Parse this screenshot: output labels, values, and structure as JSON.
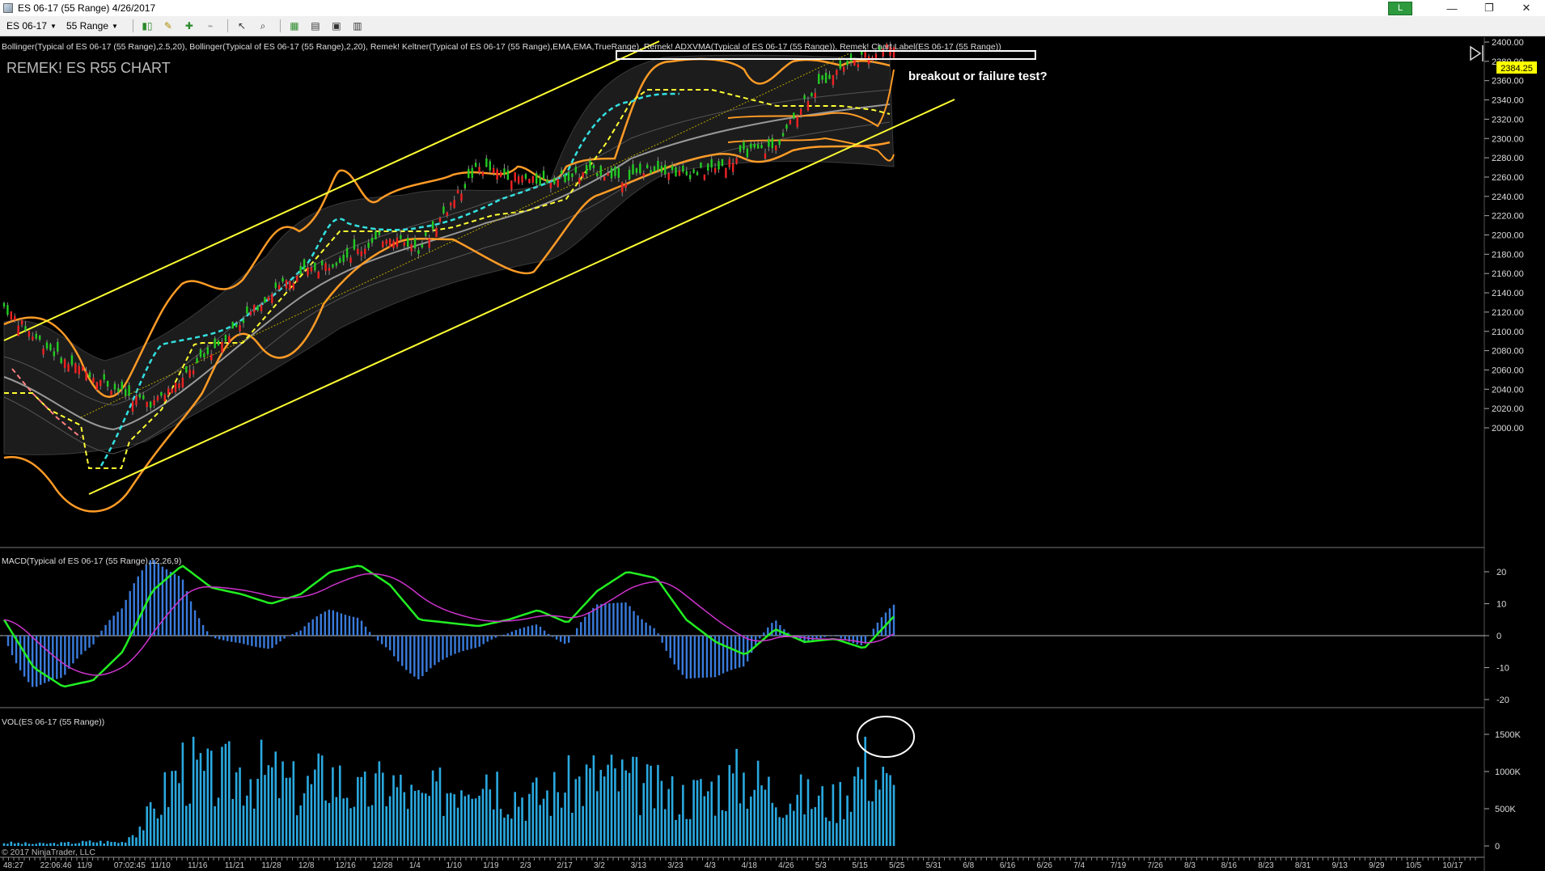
{
  "window": {
    "title": "ES 06-17 (55 Range)  4/26/2017",
    "badge": "L",
    "minimize": "—",
    "restore": "❐",
    "close": "✕"
  },
  "toolbar": {
    "instrument": "ES 06-17",
    "interval": "55 Range"
  },
  "indicators_label": "Bollinger(Typical of ES 06-17 (55 Range),2.5,20), Bollinger(Typical of ES 06-17 (55 Range),2,20), Remek! Keltner(Typical of ES 06-17 (55 Range),EMA,EMA,TrueRange), Remek! ADXVMA(Typical of ES 06-17 (55 Range)), Remek! Chart Label(ES 06-17 (55 Range))",
  "chart_label": "REMEK! ES R55 CHART",
  "annotation": "breakout or failure test?",
  "price_marker": "2384.25",
  "price_axis": [
    "2400.00",
    "2380.00",
    "2360.00",
    "2340.00",
    "2320.00",
    "2300.00",
    "2280.00",
    "2260.00",
    "2240.00",
    "2220.00",
    "2200.00",
    "2180.00",
    "2160.00",
    "2140.00",
    "2120.00",
    "2100.00",
    "2080.00",
    "2060.00",
    "2040.00",
    "2020.00",
    "2000.00"
  ],
  "macd_label": "MACD(Typical of ES 06-17 (55 Range),12,26,9)",
  "macd_axis": [
    "20",
    "10",
    "0",
    "-10",
    "-20"
  ],
  "vol_label": "VOL(ES 06-17 (55 Range))",
  "vol_axis": [
    "1500K",
    "1000K",
    "500K",
    "0"
  ],
  "copyright": "© 2017 NinjaTrader, LLC",
  "time_axis": [
    "48:27",
    "22:06:46",
    "11/9",
    "07:02:45",
    "11/10",
    "11/16",
    "11/21",
    "11/28",
    "12/8",
    "12/16",
    "12/28",
    "1/4",
    "1/10",
    "1/19",
    "2/3",
    "2/17",
    "3/2",
    "3/13",
    "3/23",
    "4/3",
    "4/18",
    "4/26",
    "5/3",
    "5/15",
    "5/25",
    "5/31",
    "6/8",
    "6/16",
    "6/26",
    "7/4",
    "7/19",
    "7/26",
    "8/3",
    "8/16",
    "8/23",
    "8/31",
    "9/13",
    "9/29",
    "10/5",
    "10/17"
  ],
  "colors": {
    "background": "#000000",
    "channel": "#ffff33",
    "bollinger_outer": "#ff9b26",
    "keltner": "#888888",
    "adxvma": "#ffff33",
    "adxvma_dn": "#ff8080",
    "trail_cyan": "#33e0e0",
    "macd": "#22ee22",
    "signal": "#cc33cc",
    "histogram": "#3a7bdc",
    "volume": "#2aa9e0",
    "price_marker_bg": "#ffff00"
  },
  "chart_data": [
    {
      "type": "line",
      "name": "price",
      "ylim": [
        1990,
        2410
      ],
      "x": [
        0,
        10,
        20,
        30,
        40,
        50,
        60,
        70,
        80,
        90,
        100,
        110,
        120,
        130,
        140,
        150,
        160,
        170,
        180,
        190,
        200,
        210,
        220,
        230,
        240,
        250,
        260,
        270,
        280,
        290,
        300
      ],
      "series": [
        {
          "values": [
            2125,
            2095,
            2070,
            2055,
            2035,
            2025,
            2050,
            2080,
            2110,
            2140,
            2160,
            2170,
            2185,
            2200,
            2185,
            2230,
            2270,
            2262,
            2255,
            2260,
            2265,
            2258,
            2270,
            2262,
            2268,
            2285,
            2290,
            2340,
            2370,
            2385,
            2398
          ]
        }
      ]
    },
    {
      "type": "line",
      "name": "macd",
      "ylim": [
        -22,
        24
      ],
      "x": [
        0,
        10,
        20,
        30,
        40,
        50,
        60,
        70,
        80,
        90,
        100,
        110,
        120,
        130,
        140,
        150,
        160,
        170,
        180,
        190,
        200,
        210,
        220,
        230,
        240,
        250,
        260,
        270,
        280,
        290,
        300
      ],
      "series": [
        {
          "values": [
            5,
            -10,
            -16,
            -14,
            -5,
            14,
            22,
            15,
            13,
            10,
            13,
            20,
            22,
            16,
            5,
            4,
            3,
            5,
            8,
            4,
            14,
            20,
            18,
            5,
            -2,
            -6,
            2,
            -2,
            -1,
            -4,
            6
          ]
        }
      ]
    },
    {
      "type": "bar",
      "name": "volume",
      "ylim": [
        0,
        1800
      ],
      "x": [
        0,
        10,
        20,
        30,
        40,
        50,
        60,
        70,
        80,
        90,
        100,
        110,
        120,
        130,
        140,
        150,
        160,
        170,
        180,
        190,
        200,
        210,
        220,
        230,
        240,
        250,
        260,
        270,
        280,
        290,
        300
      ],
      "values": [
        60,
        40,
        50,
        80,
        70,
        600,
        1500,
        1200,
        1400,
        1300,
        1000,
        1350,
        900,
        1200,
        800,
        1100,
        1600,
        1000,
        900,
        1100,
        1300,
        1200,
        1000,
        900,
        1100,
        1300,
        1000,
        900,
        800,
        1500,
        1000
      ]
    }
  ]
}
